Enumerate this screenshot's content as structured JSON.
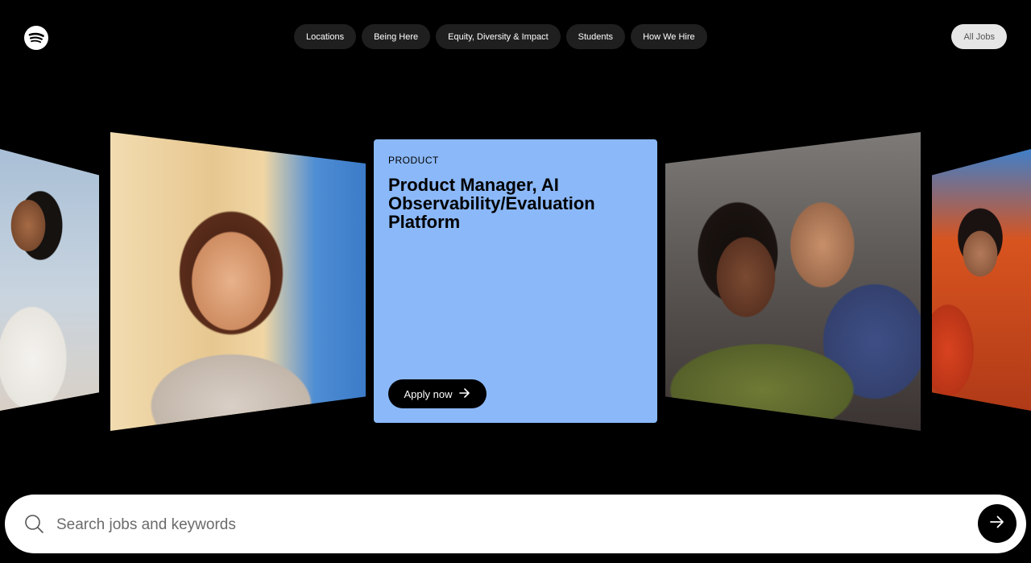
{
  "header": {
    "logo_icon": "spotify-logo-icon",
    "nav": [
      {
        "label": "Locations"
      },
      {
        "label": "Being Here"
      },
      {
        "label": "Equity, Diversity & Impact"
      },
      {
        "label": "Students"
      },
      {
        "label": "How We Hire"
      }
    ],
    "all_jobs_label": "All Jobs"
  },
  "carousel": {
    "featured_job": {
      "category": "PRODUCT",
      "title": "Product Manager, AI Observability/Evaluation Platform",
      "apply_label": "Apply now",
      "apply_icon": "arrow-right-icon",
      "background_color": "#8bb8f8"
    }
  },
  "search": {
    "placeholder": "Search jobs and keywords",
    "value": "",
    "icon": "search-icon",
    "submit_icon": "arrow-right-icon"
  }
}
